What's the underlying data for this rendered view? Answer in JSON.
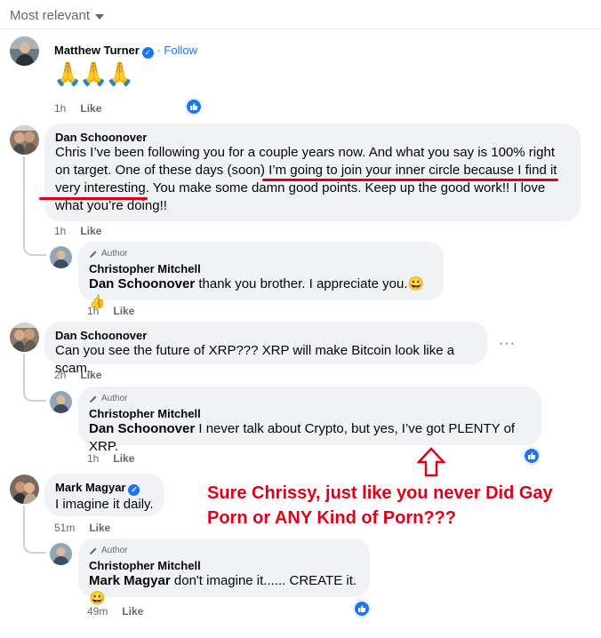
{
  "sort": {
    "label": "Most relevant"
  },
  "comments": [
    {
      "name": "Matthew Turner",
      "follow": "Follow",
      "text": "🙏🙏🙏",
      "time": "1h",
      "like": "Like"
    },
    {
      "name": "Dan Schoonover",
      "text": "Chris I’ve been following you for a couple years now. And what you say is 100% right on target. One of these days (soon) I’m going to join your inner circle because I find it very interesting. You make some damn good points. Keep up the good work!! I love what you’re doing!!",
      "time": "1h",
      "like": "Like",
      "reply": {
        "author_tag": "Author",
        "name": "Christopher Mitchell",
        "mention": "Dan Schoonover",
        "text": " thank you brother. I appreciate you.😀👍",
        "time": "1h",
        "like": "Like"
      }
    },
    {
      "name": "Dan Schoonover",
      "text": "Can you see the future of XRP??? XRP will make Bitcoin look like a scam.",
      "time": "2h",
      "like": "Like",
      "more": "···",
      "reply": {
        "author_tag": "Author",
        "name": "Christopher Mitchell",
        "mention": "Dan Schoonover",
        "text": " I never talk about Crypto, but yes, I’ve got PLENTY of XRP.",
        "time": "1h",
        "like": "Like"
      }
    },
    {
      "name": "Mark Magyar",
      "text": "I imagine it daily.",
      "time": "51m",
      "like": "Like",
      "reply": {
        "author_tag": "Author",
        "name": "Christopher Mitchell",
        "mention": "Mark Magyar",
        "text": " don't imagine it...... CREATE it.😀",
        "time": "49m",
        "like": "Like"
      }
    }
  ],
  "annotation": {
    "text": "Sure Chrissy, just like you never Did Gay Porn or ANY Kind of Porn???",
    "color": "#e00018"
  },
  "colors": {
    "accent": "#1877f2",
    "bubble": "#f0f2f5",
    "meta": "#65676b"
  }
}
